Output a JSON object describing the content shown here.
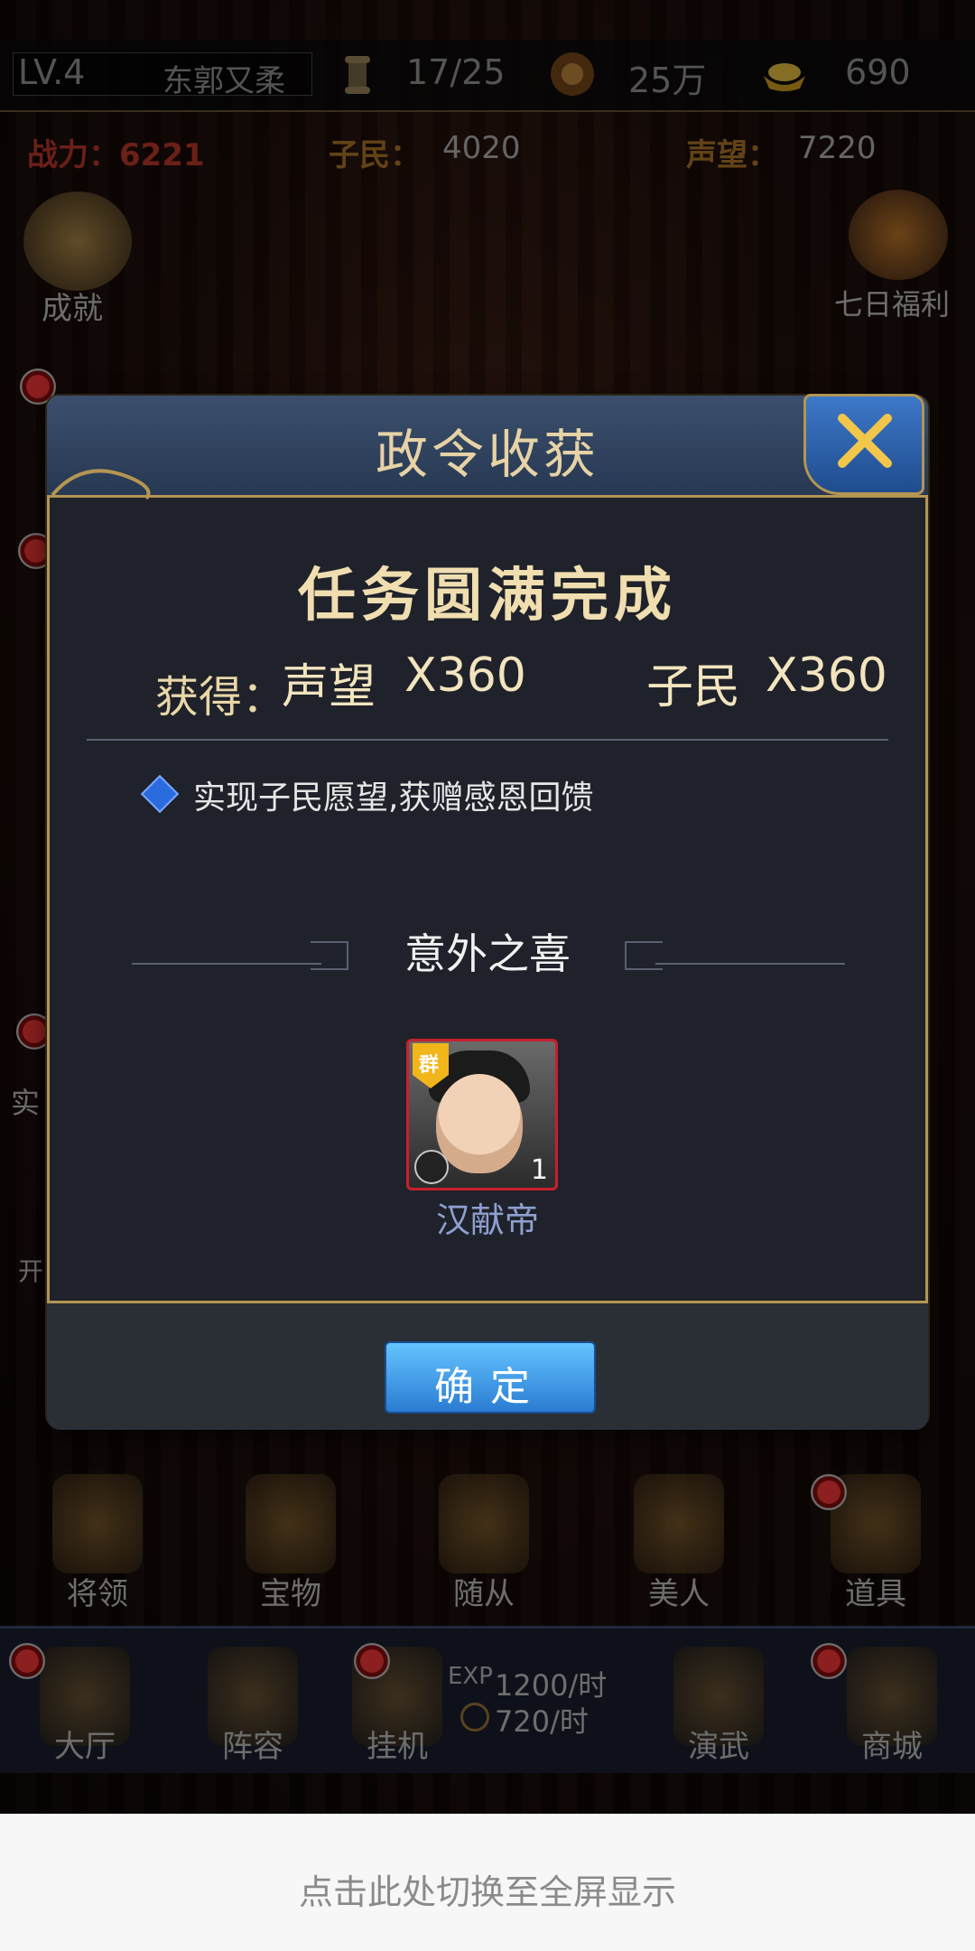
{
  "topbar": {
    "level": "LV.4",
    "player_name": "东郭又柔",
    "orders": "17/25",
    "coins": "25万",
    "gold": "690"
  },
  "stats": {
    "power": "战力：6221",
    "people_label": "子民：",
    "people_value": "4020",
    "prestige_label": "声望：",
    "prestige_value": "7220"
  },
  "side_left": {
    "achievement": "成就",
    "shi": "实",
    "kai": "开"
  },
  "side_right": {
    "seven_day": "七日福利"
  },
  "modal": {
    "title": "政令收获",
    "headline": "任务圆满完成",
    "gain_label": "获得：",
    "gains": [
      {
        "name": "声望",
        "amount": "X360"
      },
      {
        "name": "子民",
        "amount": "X360"
      }
    ],
    "bullet_text": "实现子民愿望,获赠感恩回馈",
    "bonus_title": "意外之喜",
    "hero": {
      "faction": "群",
      "level": "1",
      "name": "汉献帝"
    },
    "confirm_label": "确定"
  },
  "bottom_row1": [
    "将领",
    "宝物",
    "随从",
    "美人",
    "道具"
  ],
  "bottom_row2": {
    "items": [
      "大厅",
      "阵容",
      "挂机",
      "演武",
      "商城"
    ],
    "exp_rate": "1200/时",
    "coin_rate": "720/时",
    "exp_tag": "EXP"
  },
  "hint": "点击此处切换至全屏显示",
  "colors": {
    "accent_gold": "#b49552",
    "button_blue": "#2a7cd2",
    "red_badge": "#c81f2d"
  }
}
